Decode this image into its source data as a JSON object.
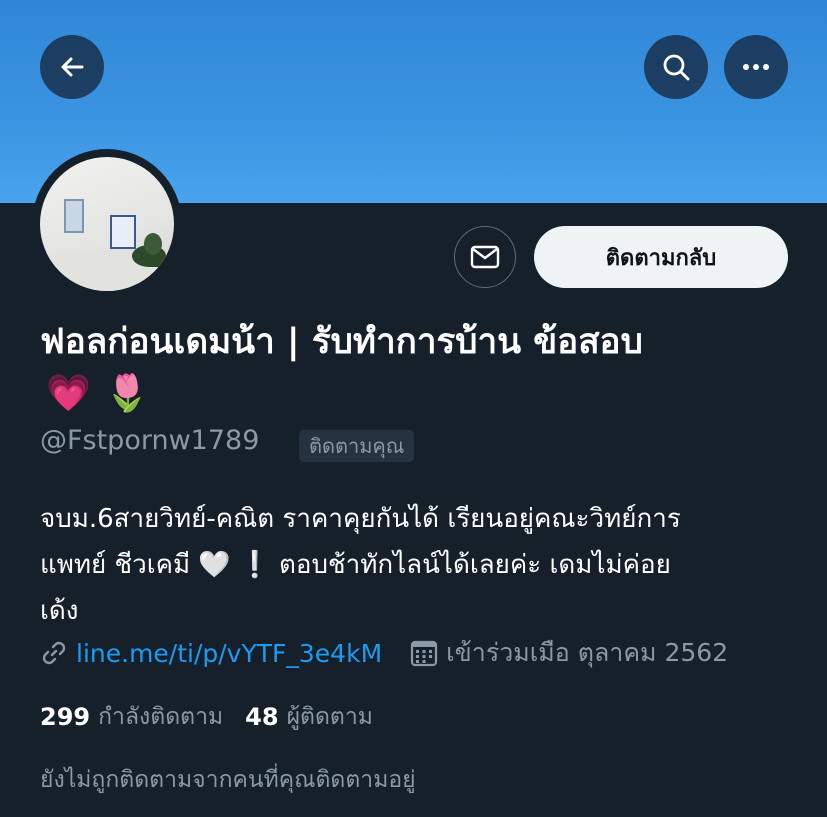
{
  "header": {
    "back_icon": "arrow-left-icon",
    "search_icon": "search-icon",
    "more_icon": "more-horizontal-icon",
    "banner_color": "#3a93e0"
  },
  "profile": {
    "display_name": "ฟอลก่อนเดมน้า | รับทำการบ้าน ข้อสอบ",
    "name_emojis": [
      "💗",
      "🌷"
    ],
    "handle": "@Fstpornw1789",
    "follows_you_badge": "ติดตามคุณ",
    "message_icon": "mail-icon",
    "follow_back_label": "ติดตามกลับ",
    "bio": {
      "line1": "จบม.6สายวิทย์-คณิต ราคาคุยกันได้ เรียนอยู่คณะวิทย์การ",
      "line2_before": "แพทย์ ชีวเคมี",
      "line2_emoji": "🤍",
      "line2_mark": "❕",
      "line2_after": "ตอบช้าทักไลน์ได้เลยค่ะ เดมไม่ค่อย",
      "line3": "เด้ง"
    },
    "link_icon": "link-icon",
    "link_text": "line.me/ti/p/vYTF_3e4kM",
    "calendar_icon": "calendar-icon",
    "joined_text": "เข้าร่วมเมือ ตุลาคม 2562",
    "following_count": "299",
    "following_label": "กำลังติดตาม",
    "followers_count": "48",
    "followers_label": "ผู้ติดตาม",
    "not_followed_text": "ยังไม่ถูกติดตามจากคนที่คุณติดตามอยู่"
  },
  "colors": {
    "background": "#15202b",
    "link": "#1d9bf0",
    "secondary_text": "#8b98a5"
  }
}
